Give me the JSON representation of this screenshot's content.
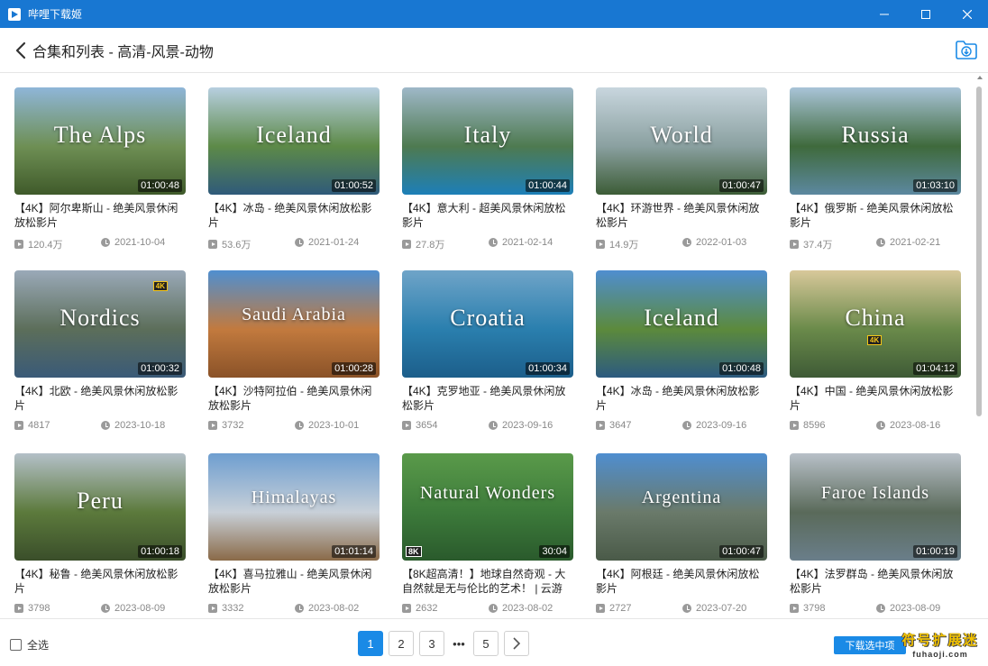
{
  "window": {
    "title": "哔哩下载姬"
  },
  "header": {
    "title": "合集和列表 - 高清-风景-动物"
  },
  "cards": [
    {
      "thumb_text": "The Alps",
      "duration": "01:00:48",
      "title": "【4K】阿尔卑斯山 - 绝美风景休闲放松影片",
      "views": "120.4万",
      "date": "2021-10-04",
      "colors": [
        "#8fb6d8",
        "#6e8f54",
        "#3f5a2a"
      ]
    },
    {
      "thumb_text": "Iceland",
      "duration": "01:00:52",
      "title": "【4K】冰岛 - 绝美风景休闲放松影片",
      "views": "53.6万",
      "date": "2021-01-24",
      "colors": [
        "#b7cfe0",
        "#5d8a48",
        "#2f5a7a"
      ]
    },
    {
      "thumb_text": "Italy",
      "duration": "01:00:44",
      "title": "【4K】意大利 - 超美风景休闲放松影片",
      "views": "27.8万",
      "date": "2021-02-14",
      "colors": [
        "#9fb8c8",
        "#4e7a50",
        "#1d7fb8"
      ]
    },
    {
      "thumb_text": "World",
      "duration": "01:00:47",
      "title": "【4K】环游世界 - 绝美风景休闲放松影片",
      "views": "14.9万",
      "date": "2022-01-03",
      "colors": [
        "#c8d6de",
        "#8aa0a0",
        "#3c5c36"
      ]
    },
    {
      "thumb_text": "Russia",
      "duration": "01:03:10",
      "title": "【4K】俄罗斯 - 绝美风景休闲放松影片",
      "views": "37.4万",
      "date": "2021-02-21",
      "colors": [
        "#a9c4d8",
        "#3f6a3c",
        "#5c88a0"
      ]
    },
    {
      "thumb_text": "Nordics",
      "duration": "01:00:32",
      "title": "【4K】北欧 - 绝美风景休闲放松影片",
      "views": "4817",
      "date": "2023-10-18",
      "colors": [
        "#9aa9b8",
        "#5c6e5a",
        "#3a5a78"
      ],
      "badge": "4K"
    },
    {
      "thumb_text": "Saudi Arabia",
      "duration": "01:00:28",
      "title": "【4K】沙特阿拉伯 - 绝美风景休闲放松影片",
      "views": "3732",
      "date": "2023-10-01",
      "colors": [
        "#4f8fd0",
        "#c27a3e",
        "#8a5228"
      ]
    },
    {
      "thumb_text": "Croatia",
      "duration": "01:00:34",
      "title": "【4K】克罗地亚 - 绝美风景休闲放松影片",
      "views": "3654",
      "date": "2023-09-16",
      "colors": [
        "#6fa4c8",
        "#2a7fae",
        "#1c5e8a"
      ]
    },
    {
      "thumb_text": "Iceland",
      "duration": "01:00:48",
      "title": "【4K】冰岛 - 绝美风景休闲放松影片",
      "views": "3647",
      "date": "2023-09-16",
      "colors": [
        "#4f8ed0",
        "#5c8a3c",
        "#2c5a80"
      ]
    },
    {
      "thumb_text": "China",
      "duration": "01:04:12",
      "title": "【4K】中国 - 绝美风景休闲放松影片",
      "views": "8596",
      "date": "2023-08-16",
      "colors": [
        "#d8c89a",
        "#6a8a4a",
        "#3e5a36"
      ],
      "badge": "4K"
    },
    {
      "thumb_text": "Peru",
      "duration": "01:00:18",
      "title": "【4K】秘鲁 - 绝美风景休闲放松影片",
      "views": "3798",
      "date": "2023-08-09",
      "colors": [
        "#b4c0c8",
        "#5c7a3c",
        "#3a4e2a"
      ]
    },
    {
      "thumb_text": "Himalayas",
      "duration": "01:01:14",
      "title": "【4K】喜马拉雅山 - 绝美风景休闲放松影片",
      "views": "3332",
      "date": "2023-08-02",
      "colors": [
        "#6e9ed0",
        "#c8d0d8",
        "#8a6a48"
      ]
    },
    {
      "thumb_text": "Natural Wonders",
      "duration": "30:04",
      "title": "【8K超高清！】地球自然奇观 - 大自然就是无与伦比的艺术！ | 云游",
      "views": "2632",
      "date": "2023-08-02",
      "colors": [
        "#5a9a4a",
        "#3c7a3a",
        "#2a5a2c"
      ],
      "badge8k": "8K"
    },
    {
      "thumb_text": "Argentina",
      "duration": "01:00:47",
      "title": "【4K】阿根廷 - 绝美风景休闲放松影片",
      "views": "2727",
      "date": "2023-07-20",
      "colors": [
        "#4f8ed0",
        "#6a7a6a",
        "#4a5a48"
      ]
    },
    {
      "thumb_text": "Faroe Islands",
      "duration": "01:00:19",
      "title": "【4K】法罗群岛 - 绝美风景休闲放松影片",
      "views": "3798",
      "date": "2023-08-09",
      "colors": [
        "#b8c0c8",
        "#5a6a5a",
        "#6a7e8a"
      ]
    }
  ],
  "footer": {
    "select_all": "全选",
    "pages": [
      "1",
      "2",
      "3",
      "5"
    ],
    "ellipsis": "•••",
    "current_page": "1",
    "download_label": "下载选中项",
    "watermark_line1": "符号扩展迷",
    "watermark_line2": "fuhaoji.com"
  },
  "colors": {
    "accent": "#1a8ae6",
    "titlebar": "#1877d2"
  }
}
